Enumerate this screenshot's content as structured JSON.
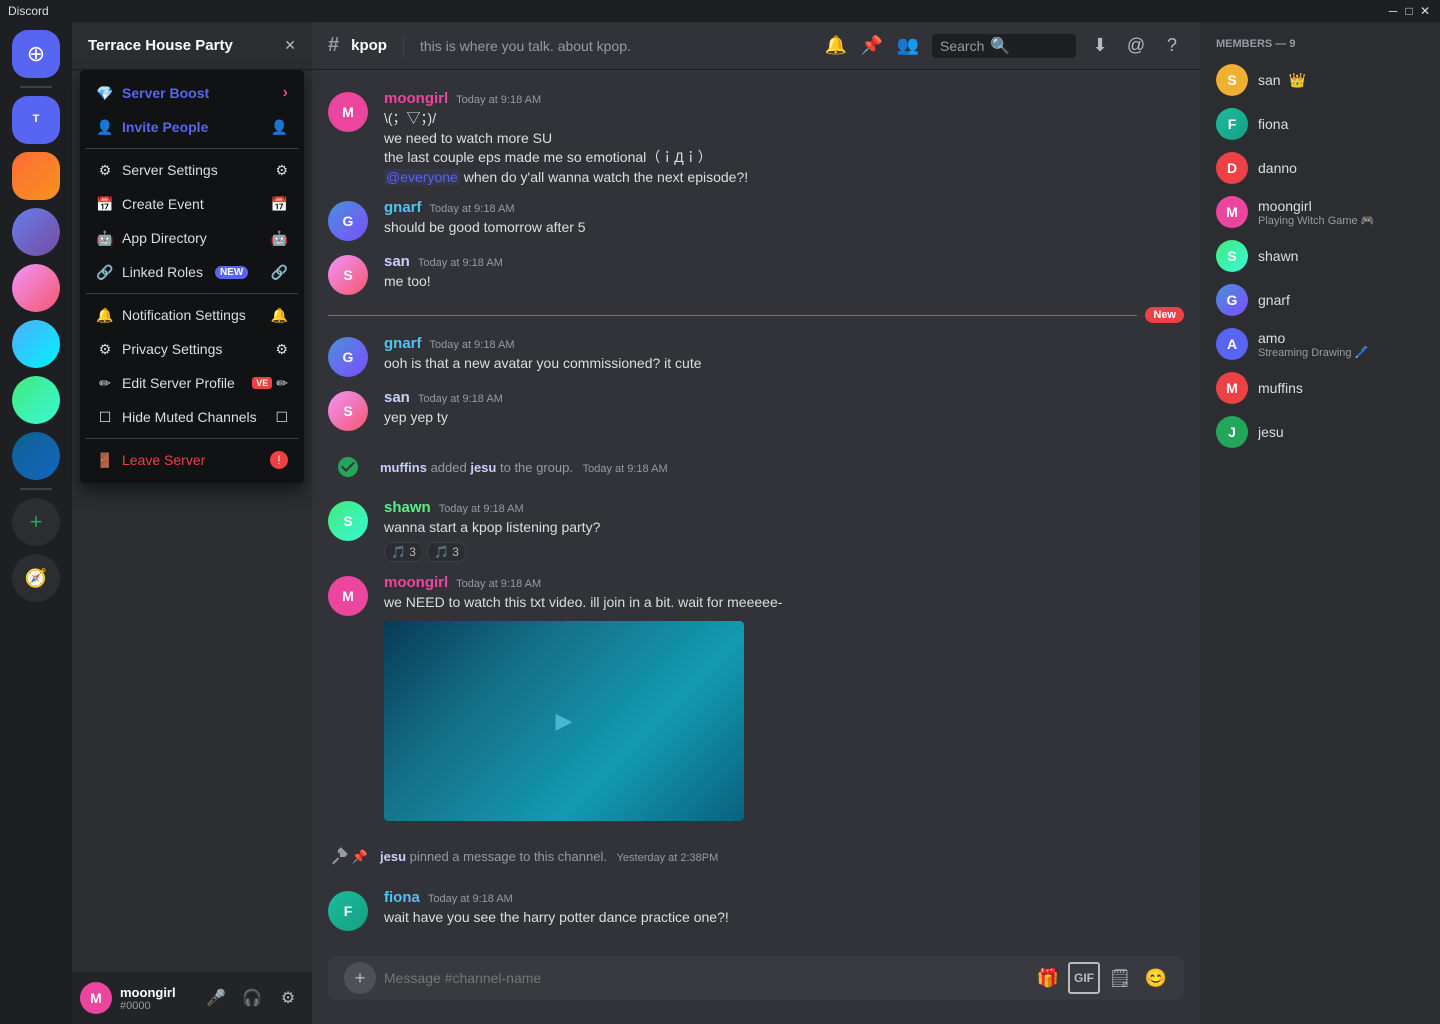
{
  "titlebar": {
    "app_name": "Discord"
  },
  "server": {
    "name": "Terrace House Party",
    "channel_name": "kpop",
    "channel_description": "this is where you talk. about kpop."
  },
  "dropdown": {
    "items": [
      {
        "id": "server-boost",
        "label": "Server Boost",
        "icon": "💎",
        "danger": false,
        "highlight": false,
        "new_badge": false
      },
      {
        "id": "invite-people",
        "label": "Invite People",
        "icon": "👤+",
        "danger": false,
        "highlight": true,
        "new_badge": false
      },
      {
        "id": "server-settings",
        "label": "Server Settings",
        "icon": "⚙",
        "danger": false,
        "highlight": false,
        "new_badge": false
      },
      {
        "id": "create-event",
        "label": "Create Event",
        "icon": "📅",
        "danger": false,
        "highlight": false,
        "new_badge": false
      },
      {
        "id": "app-directory",
        "label": "App Directory",
        "icon": "🤖",
        "danger": false,
        "highlight": false,
        "new_badge": false
      },
      {
        "id": "linked-roles",
        "label": "Linked Roles",
        "icon": "🔗",
        "danger": false,
        "highlight": false,
        "new_badge": true
      },
      {
        "id": "notification-settings",
        "label": "Notification Settings",
        "icon": "🔔",
        "danger": false,
        "highlight": false,
        "new_badge": false
      },
      {
        "id": "privacy-settings",
        "label": "Privacy Settings",
        "icon": "⚙",
        "danger": false,
        "highlight": false,
        "new_badge": false
      },
      {
        "id": "edit-server-profile",
        "label": "Edit Server Profile",
        "icon": "✏",
        "danger": false,
        "highlight": false,
        "new_badge": false
      },
      {
        "id": "hide-muted-channels",
        "label": "Hide Muted Channels",
        "icon": "☐",
        "danger": false,
        "highlight": false,
        "new_badge": false
      },
      {
        "id": "leave-server",
        "label": "Leave Server",
        "icon": "🚪",
        "danger": true,
        "highlight": false,
        "new_badge": false
      }
    ],
    "new_badge_label": "NEW"
  },
  "search": {
    "placeholder": "Search"
  },
  "messages": [
    {
      "id": "msg1",
      "author": "moongirl",
      "author_color": "color-pink",
      "time": "Today at 9:18 AM",
      "lines": [
        "\\(；▽；)/",
        "we need to watch more SU",
        "the last couple eps made me so emotional（ｉДｉ）",
        "@everyone when do y'all wanna watch the next episode?!"
      ],
      "has_mention": true,
      "mention_text": "@everyone",
      "avatar_color": "av-pink",
      "avatar_initial": "M"
    },
    {
      "id": "msg2",
      "author": "gnarf",
      "author_color": "color-blue",
      "time": "Today at 9:18 AM",
      "lines": [
        "should be good tomorrow after 5"
      ],
      "avatar_color": "av-blue",
      "avatar_initial": "G"
    },
    {
      "id": "msg3",
      "author": "san",
      "author_color": "color-purple",
      "time": "Today at 9:18 AM",
      "lines": [
        "me too!"
      ],
      "avatar_color": "av-purple",
      "avatar_initial": "S"
    },
    {
      "id": "msg4",
      "author": "gnarf",
      "author_color": "color-blue",
      "time": "Today at 9:18 AM",
      "lines": [
        "ooh is that a new avatar you commissioned? it cute"
      ],
      "new_divider": true,
      "avatar_color": "av-blue",
      "avatar_initial": "G"
    },
    {
      "id": "msg5",
      "author": "san",
      "author_color": "color-purple",
      "time": "Today at 9:18 AM",
      "lines": [
        "yep yep ty"
      ],
      "avatar_color": "av-purple",
      "avatar_initial": "S"
    },
    {
      "id": "msg6_system",
      "type": "system",
      "text": "muffins added jesu to the group.",
      "time": "Today at 9:18 AM",
      "mention1": "muffins",
      "mention2": "jesu"
    },
    {
      "id": "msg7",
      "author": "shawn",
      "author_color": "color-green",
      "time": "Today at 9:18 AM",
      "lines": [
        "wanna start a kpop listening party?"
      ],
      "reactions": [
        {
          "emoji": "🎵",
          "count": "3"
        },
        {
          "emoji": "🎵",
          "count": "3"
        }
      ],
      "avatar_color": "av-green",
      "avatar_initial": "S"
    },
    {
      "id": "msg8",
      "author": "moongirl",
      "author_color": "color-pink",
      "time": "Today at 9:18 AM",
      "lines": [
        "we NEED to watch this txt video. ill join in a bit. wait for meeeee-"
      ],
      "has_video": true,
      "avatar_color": "av-pink",
      "avatar_initial": "M"
    }
  ],
  "system_event": {
    "pin_text": "jesu pinned a message to this channel.",
    "pin_time": "Yesterday at 2:38PM",
    "pin_actor": "jesu"
  },
  "last_message": {
    "author": "fiona",
    "author_color": "color-blue",
    "time": "Today at 9:18 AM",
    "text": "wait have you see the harry potter dance practice one?!",
    "avatar_color": "av-teal",
    "avatar_initial": "F"
  },
  "chat_input": {
    "placeholder": "Message #channel-name"
  },
  "members": {
    "header": "MEMBERS — 9",
    "list": [
      {
        "name": "san",
        "crown": true,
        "status": "",
        "color": "av-yellow",
        "initial": "S"
      },
      {
        "name": "fiona",
        "crown": false,
        "status": "",
        "color": "av-teal",
        "initial": "F"
      },
      {
        "name": "danno",
        "crown": false,
        "status": "",
        "color": "av-orange",
        "initial": "D"
      },
      {
        "name": "moongirl",
        "crown": false,
        "status": "Playing Witch Game 🎮",
        "color": "av-pink",
        "initial": "M"
      },
      {
        "name": "shawn",
        "crown": false,
        "status": "",
        "color": "av-green",
        "initial": "S"
      },
      {
        "name": "gnarf",
        "crown": false,
        "status": "",
        "color": "av-blue",
        "initial": "G"
      },
      {
        "name": "amo",
        "crown": false,
        "status": "Streaming Drawing 🖊️",
        "color": "av-purple",
        "initial": "A"
      },
      {
        "name": "muffins",
        "crown": false,
        "status": "",
        "color": "av-orange",
        "initial": "M"
      },
      {
        "name": "jesu",
        "crown": false,
        "status": "",
        "color": "av-green",
        "initial": "J"
      }
    ]
  },
  "user": {
    "name": "moongirl",
    "tag": "#0000",
    "avatar_color": "av-pink",
    "avatar_initial": "M"
  }
}
